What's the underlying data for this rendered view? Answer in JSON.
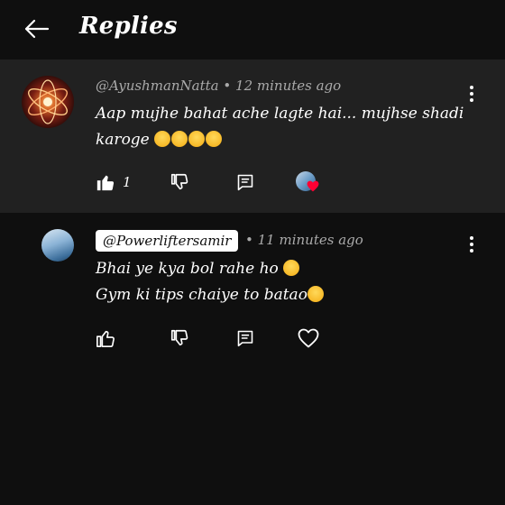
{
  "header": {
    "title": "Replies"
  },
  "parent_comment": {
    "author": "@AyushmanNatta",
    "separator": "•",
    "time": "12 minutes ago",
    "text": "Aap mujhe bahat ache lagte hai... mujhse shadi karoge",
    "emoji_count": 4,
    "like_count": "1"
  },
  "reply": {
    "mention": "@Powerliftersamir",
    "separator": "•",
    "time": "11 minutes ago",
    "line1": "Bhai ye kya bol rahe ho",
    "line2": "Gym ki tips chaiye to batao"
  },
  "icons": {
    "back": "arrow-left-icon",
    "like": "thumbs-up-icon",
    "dislike": "thumbs-down-icon",
    "reply": "comment-icon",
    "more": "more-vert-icon",
    "heart": "heart-icon"
  },
  "colors": {
    "background": "#0f0f0f",
    "parent_bg": "#212121",
    "meta": "#aaaaaa",
    "heart": "#ff0033"
  }
}
